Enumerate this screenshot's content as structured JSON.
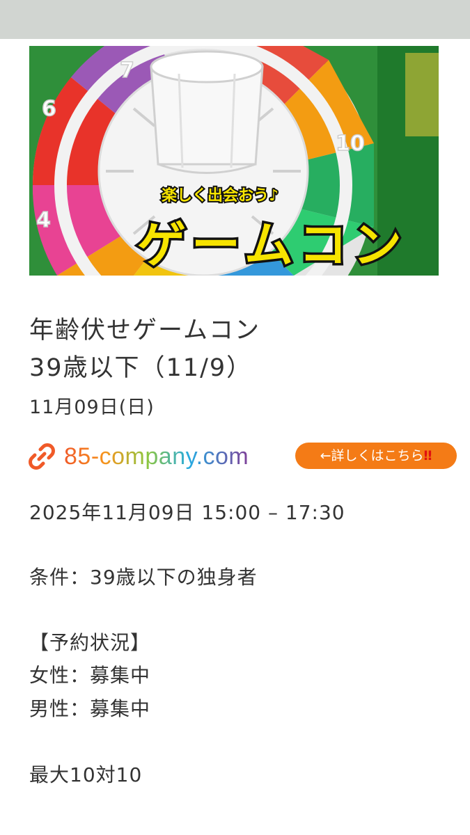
{
  "hero": {
    "catch_copy": "楽しく出会おう♪",
    "big_title": "ゲームコン"
  },
  "event": {
    "title_line1": "年齢伏せゲームコン",
    "title_line2": "39歳以下（11/9）",
    "date_short": "11月09日(日)"
  },
  "link": {
    "icon": "link-icon",
    "domain": "85-company.com",
    "details_label": "←詳しくはこちら",
    "details_suffix": "‼"
  },
  "details": {
    "datetime": "2025年11月09日 15:00 – 17:30",
    "condition": "条件：39歳以下の独身者",
    "status_heading": "【予約状況】",
    "female_status": "女性：募集中",
    "male_status": "男性：募集中",
    "capacity": "最大10対10"
  },
  "colors": {
    "top_bar": "#d1d5d1",
    "accent_button": "#f47b16",
    "link_icon": "#f05a28",
    "text": "#333333"
  }
}
